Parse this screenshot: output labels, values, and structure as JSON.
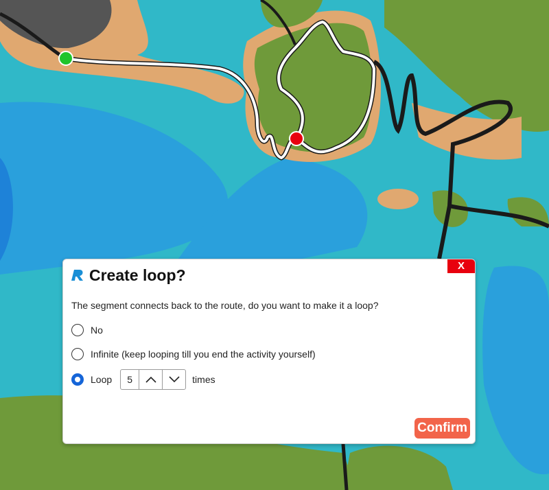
{
  "colors": {
    "close": "#e8000e",
    "confirm": "#f2644a",
    "radio_checked": "#1565d8"
  },
  "map": {
    "start_marker": "start-marker-green",
    "end_marker": "end-marker-red"
  },
  "dialog": {
    "title": "Create loop?",
    "close_label": "X",
    "message": "The segment connects back to the route, do you want to make it a loop?",
    "options": [
      {
        "label": "No",
        "selected": false
      },
      {
        "label": "Infinite (keep looping till you end the activity yourself)",
        "selected": false
      },
      {
        "label": "Loop",
        "selected": true
      }
    ],
    "loop_count": "5",
    "times_label": "times",
    "confirm_label": "Confirm"
  }
}
